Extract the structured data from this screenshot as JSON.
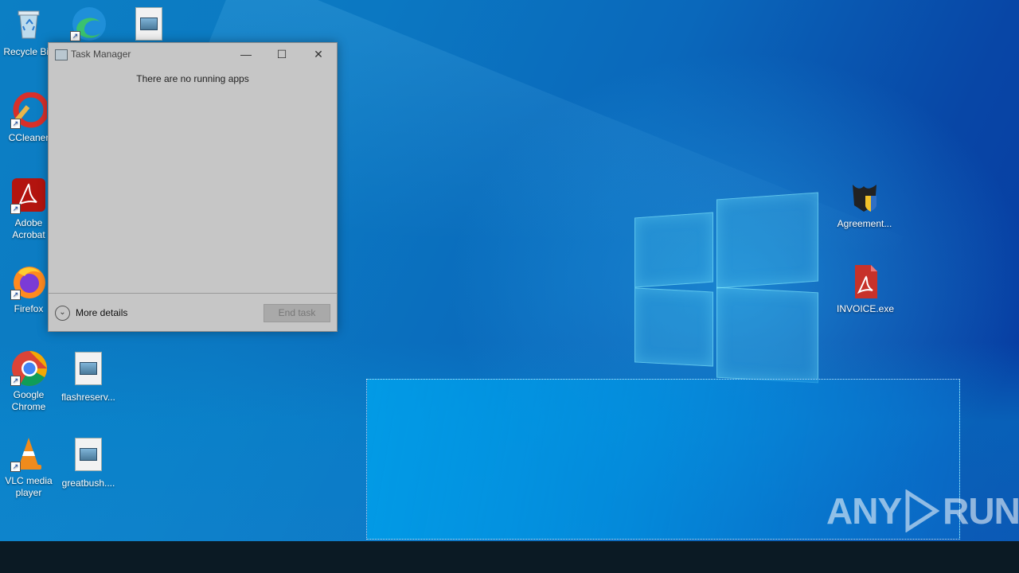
{
  "desktop": {
    "icons": {
      "recycle_bin": "Recycle Bin",
      "ccleaner": "CCleaner",
      "adobe_l1": "Adobe",
      "adobe_l2": "Acrobat",
      "firefox": "Firefox",
      "chrome_l1": "Google",
      "chrome_l2": "Chrome",
      "vlc_l1": "VLC media",
      "vlc_l2": "player",
      "flashreserv": "flashreserv...",
      "greatbush": "greatbush....",
      "agreement": "Agreement...",
      "invoice": "INVOICE.exe"
    }
  },
  "task_manager": {
    "title": "Task Manager",
    "minimize_glyph": "—",
    "maximize_glyph": "☐",
    "close_glyph": "✕",
    "message": "There are no running apps",
    "more_details_label": "More details",
    "end_task_label": "End task"
  },
  "watermark": {
    "left": "ANY",
    "right": "RUN"
  },
  "colors": {
    "wallpaper": "#0a68bb",
    "taskbar": "#0b1a24",
    "window_bg": "#c6c6c6"
  }
}
